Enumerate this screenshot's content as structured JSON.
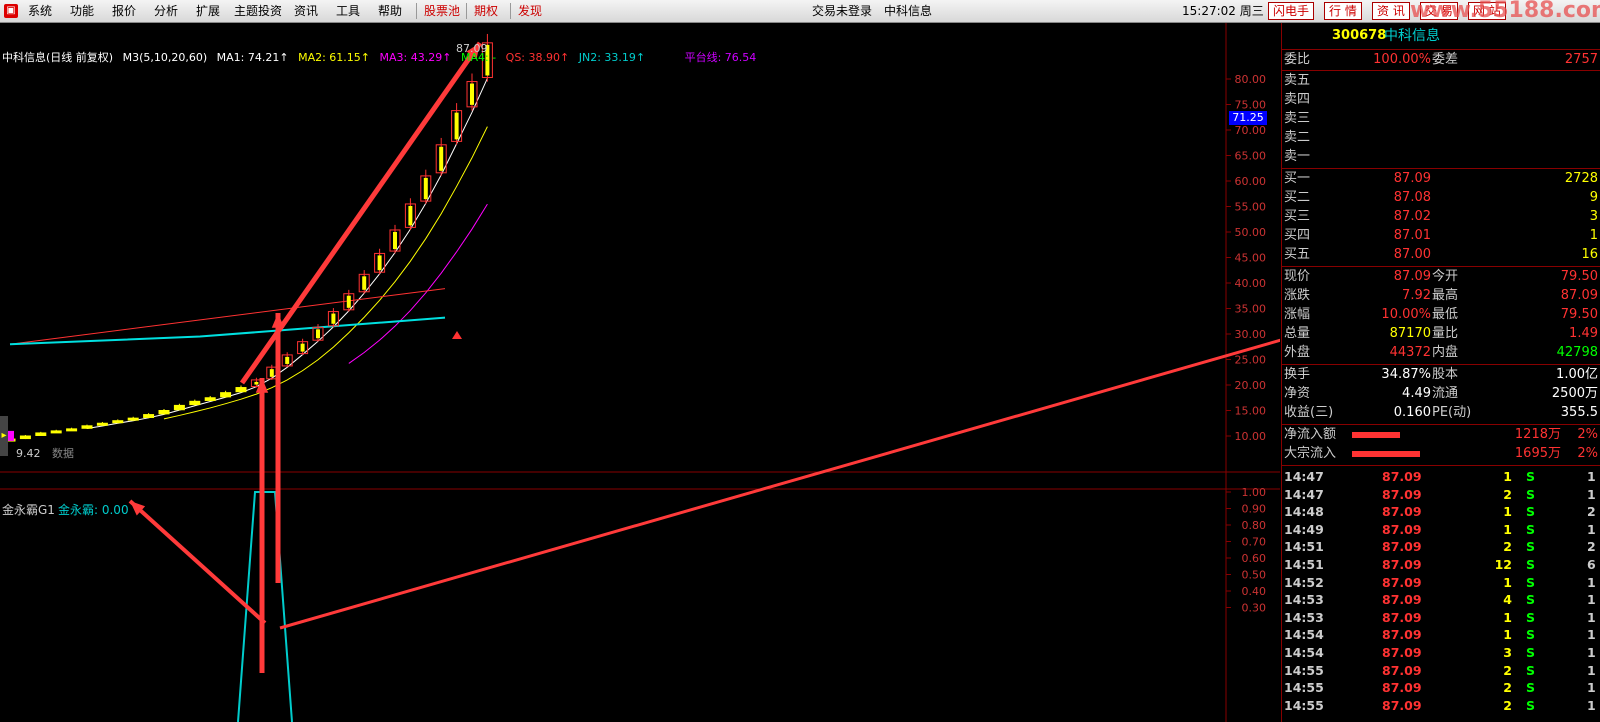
{
  "menu": {
    "items": [
      "系统",
      "功能",
      "报价",
      "分析",
      "扩展",
      "主题投资",
      "资讯",
      "工具",
      "帮助"
    ],
    "hot_items": [
      "股票池",
      "期权",
      "发现"
    ],
    "status": "交易未登录",
    "stock_name": "中科信息",
    "clock": "15:27:02 周三",
    "right_buttons": [
      "闪电手",
      "行 情",
      "资 讯",
      "交 易",
      "网 站"
    ],
    "watermark": "www.55188.com"
  },
  "chart": {
    "title": "中科信息(日线 前复权)",
    "ma_label": "M3(5,10,20,60)",
    "ma1": "MA1: 74.21↑",
    "ma2": "MA2: 61.15↑",
    "ma3": "MA3: 43.29↑",
    "ma4": "MA4: -",
    "qs": "QS: 38.90↑",
    "jn2": "JN2: 33.19↑",
    "platform": "平台线: 76.54",
    "high_label": "87.09",
    "low_label": "9.42",
    "data_label": "数据",
    "price_marker": "71.25",
    "y_ticks": [
      "80.00",
      "75.00",
      "70.00",
      "65.00",
      "60.00",
      "55.00",
      "50.00",
      "45.00",
      "40.00",
      "35.00",
      "30.00",
      "25.00",
      "20.00",
      "15.00",
      "10.00"
    ],
    "colors": {
      "up": "#ff3232",
      "down": "#00ffff",
      "ma1": "#ffffff",
      "ma2": "#ffff00",
      "ma3": "#ff00ff",
      "qs": "#ff3232",
      "jn2": "#00e0e0",
      "arrow": "#ff3a3a"
    }
  },
  "indicator": {
    "title": "金永霸G1",
    "value": "金永霸: 0.00",
    "y_ticks": [
      "1.00",
      "0.90",
      "0.80",
      "0.70",
      "0.60",
      "0.50",
      "0.40",
      "0.30"
    ]
  },
  "quote": {
    "code": "300678",
    "name": "中科信息",
    "weibi_label": "委比",
    "weibi": "100.00%",
    "weicha_label": "委差",
    "weicha": "2757",
    "sells": [
      {
        "label": "卖五",
        "price": "",
        "vol": ""
      },
      {
        "label": "卖四",
        "price": "",
        "vol": ""
      },
      {
        "label": "卖三",
        "price": "",
        "vol": ""
      },
      {
        "label": "卖二",
        "price": "",
        "vol": ""
      },
      {
        "label": "卖一",
        "price": "",
        "vol": ""
      }
    ],
    "buys": [
      {
        "label": "买一",
        "price": "87.09",
        "vol": "2728"
      },
      {
        "label": "买二",
        "price": "87.08",
        "vol": "9"
      },
      {
        "label": "买三",
        "price": "87.02",
        "vol": "3"
      },
      {
        "label": "买四",
        "price": "87.01",
        "vol": "1"
      },
      {
        "label": "买五",
        "price": "87.00",
        "vol": "16"
      }
    ],
    "stats": [
      {
        "l1": "现价",
        "v1": "87.09",
        "c1": "red",
        "l2": "今开",
        "v2": "79.50",
        "c2": "red"
      },
      {
        "l1": "涨跌",
        "v1": "7.92",
        "c1": "red",
        "l2": "最高",
        "v2": "87.09",
        "c2": "red"
      },
      {
        "l1": "涨幅",
        "v1": "10.00%",
        "c1": "red",
        "l2": "最低",
        "v2": "79.50",
        "c2": "red"
      },
      {
        "l1": "总量",
        "v1": "87170",
        "c1": "yel",
        "l2": "量比",
        "v2": "1.49",
        "c2": "red"
      },
      {
        "l1": "外盘",
        "v1": "44372",
        "c1": "red",
        "l2": "内盘",
        "v2": "42798",
        "c2": "green"
      }
    ],
    "fund": [
      {
        "l1": "换手",
        "v1": "34.87%",
        "l2": "股本",
        "v2": "1.00亿"
      },
      {
        "l1": "净资",
        "v1": "4.49",
        "l2": "流通",
        "v2": "2500万"
      },
      {
        "l1": "收益(三)",
        "v1": "0.160",
        "l2": "PE(动)",
        "v2": "355.5"
      }
    ],
    "flow": [
      {
        "label": "净流入额",
        "value": "1218万",
        "pct": "2%",
        "bar": 0.6
      },
      {
        "label": "大宗流入",
        "value": "1695万",
        "pct": "2%",
        "bar": 0.85
      }
    ],
    "ticks": [
      {
        "t": "14:47",
        "p": "87.09",
        "v": "1",
        "s": "S",
        "n": "1"
      },
      {
        "t": "14:47",
        "p": "87.09",
        "v": "2",
        "s": "S",
        "n": "1"
      },
      {
        "t": "14:48",
        "p": "87.09",
        "v": "1",
        "s": "S",
        "n": "2"
      },
      {
        "t": "14:49",
        "p": "87.09",
        "v": "1",
        "s": "S",
        "n": "1"
      },
      {
        "t": "14:51",
        "p": "87.09",
        "v": "2",
        "s": "S",
        "n": "2"
      },
      {
        "t": "14:51",
        "p": "87.09",
        "v": "12",
        "s": "S",
        "n": "6"
      },
      {
        "t": "14:52",
        "p": "87.09",
        "v": "1",
        "s": "S",
        "n": "1"
      },
      {
        "t": "14:53",
        "p": "87.09",
        "v": "4",
        "s": "S",
        "n": "1"
      },
      {
        "t": "14:53",
        "p": "87.09",
        "v": "1",
        "s": "S",
        "n": "1"
      },
      {
        "t": "14:54",
        "p": "87.09",
        "v": "1",
        "s": "S",
        "n": "1"
      },
      {
        "t": "14:54",
        "p": "87.09",
        "v": "3",
        "s": "S",
        "n": "1"
      },
      {
        "t": "14:55",
        "p": "87.09",
        "v": "2",
        "s": "S",
        "n": "1"
      },
      {
        "t": "14:55",
        "p": "87.09",
        "v": "2",
        "s": "S",
        "n": "1"
      },
      {
        "t": "14:55",
        "p": "87.09",
        "v": "2",
        "s": "S",
        "n": "1"
      }
    ]
  }
}
